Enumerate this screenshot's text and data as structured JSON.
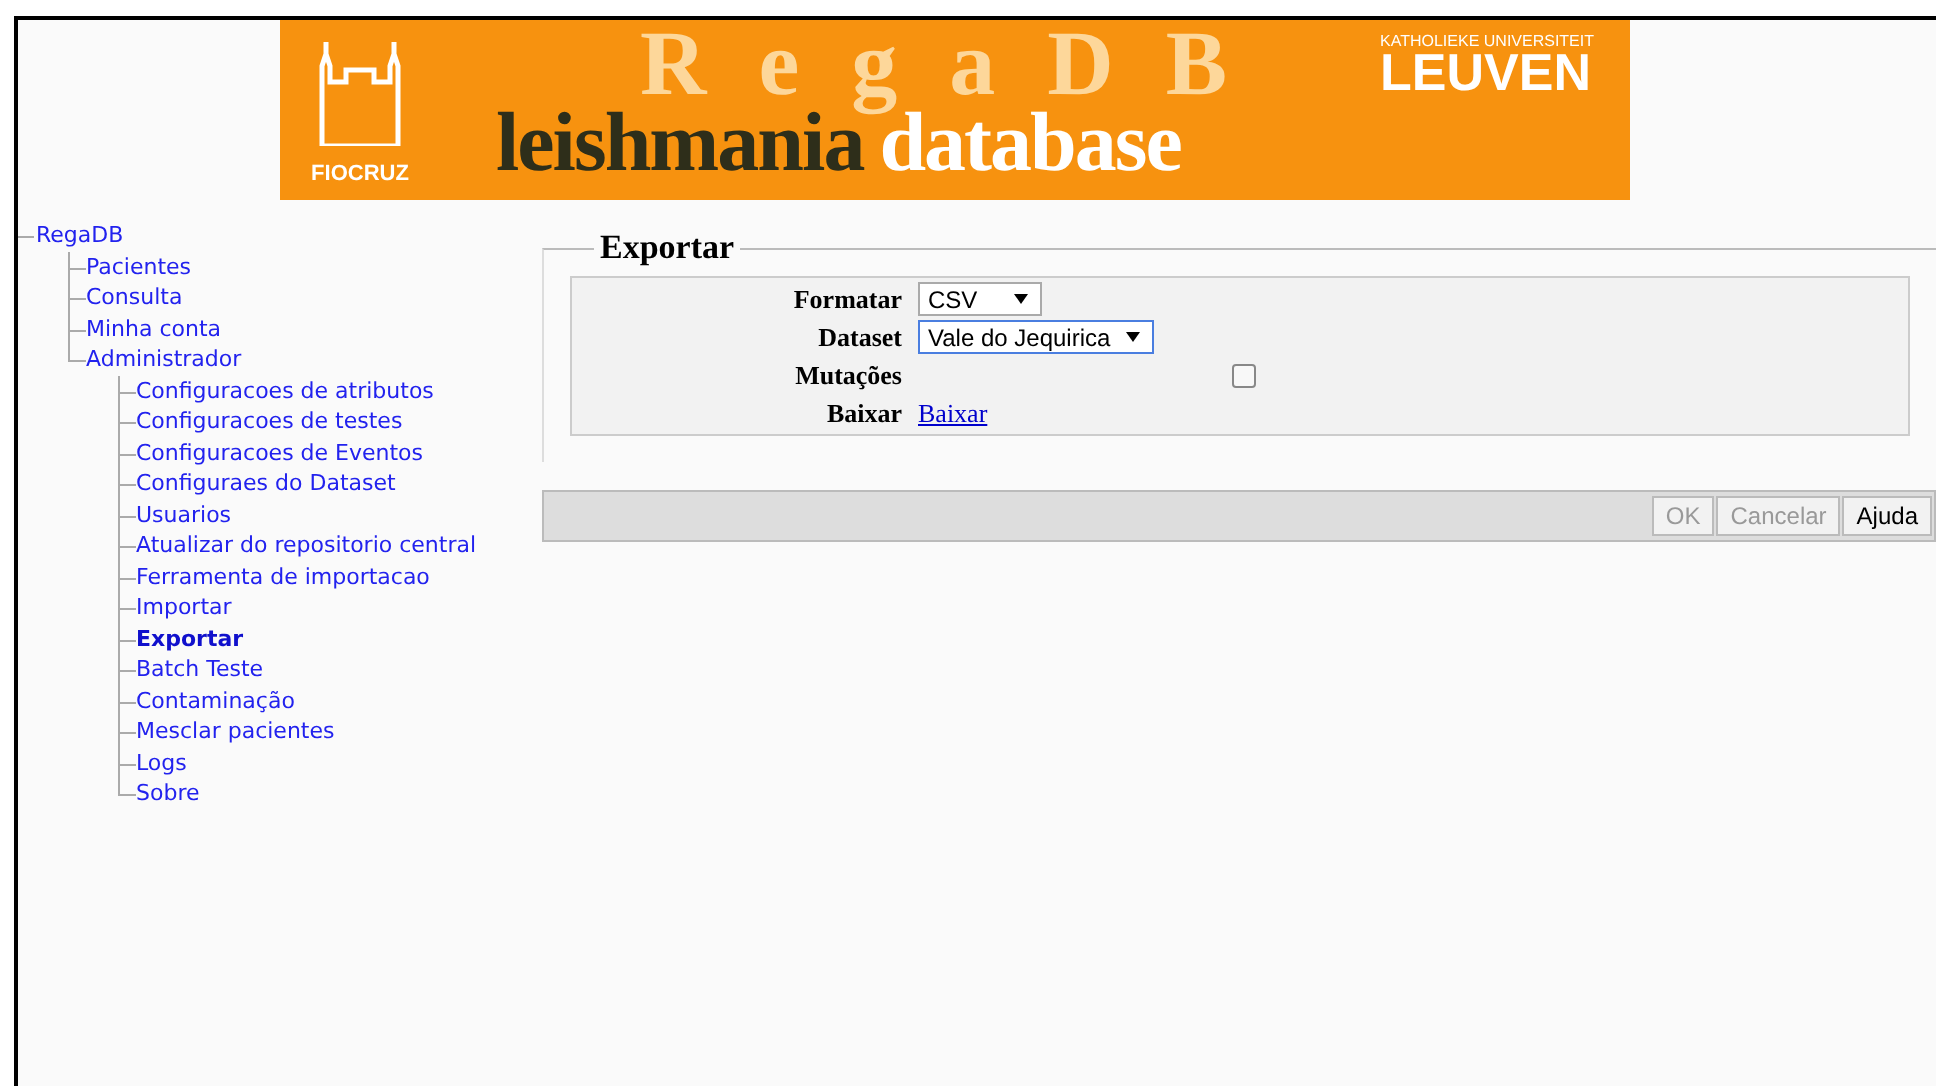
{
  "banner": {
    "watermark": "RegaDB",
    "left_logo": "FIOCRUZ",
    "title_dark": "leishmania",
    "title_light": "database",
    "right_logo_small": "KATHOLIEKE UNIVERSITEIT",
    "right_logo_big": "LEUVEN"
  },
  "tree": [
    {
      "label": "RegaDB",
      "selected": false,
      "children": [
        {
          "label": "Pacientes",
          "selected": false
        },
        {
          "label": "Consulta",
          "selected": false
        },
        {
          "label": "Minha conta",
          "selected": false
        },
        {
          "label": "Administrador",
          "selected": false,
          "children": [
            {
              "label": "Configuracoes de atributos",
              "selected": false
            },
            {
              "label": "Configuracoes de testes",
              "selected": false
            },
            {
              "label": "Configuracoes de Eventos",
              "selected": false
            },
            {
              "label": "Configuraes do Dataset",
              "selected": false
            },
            {
              "label": "Usuarios",
              "selected": false
            },
            {
              "label": "Atualizar do repositorio central",
              "selected": false
            },
            {
              "label": "Ferramenta de importacao",
              "selected": false
            },
            {
              "label": "Importar",
              "selected": false
            },
            {
              "label": "Exportar",
              "selected": true
            },
            {
              "label": "Batch Teste",
              "selected": false
            },
            {
              "label": "Contaminação",
              "selected": false
            },
            {
              "label": "Mesclar pacientes",
              "selected": false
            },
            {
              "label": "Logs",
              "selected": false
            },
            {
              "label": "Sobre",
              "selected": false
            }
          ]
        }
      ]
    }
  ],
  "form": {
    "legend": "Exportar",
    "rows": [
      {
        "kind": "select",
        "label": "Formatar",
        "value": "CSV",
        "focused": false
      },
      {
        "kind": "select",
        "label": "Dataset",
        "value": "Vale do Jequirica",
        "focused": true
      },
      {
        "kind": "checkbox",
        "label": "Mutações",
        "checked": false
      },
      {
        "kind": "link",
        "label": "Baixar",
        "value": "Baixar"
      }
    ],
    "buttons": [
      {
        "label": "OK",
        "disabled": true
      },
      {
        "label": "Cancelar",
        "disabled": true
      },
      {
        "label": "Ajuda",
        "disabled": false
      }
    ]
  }
}
